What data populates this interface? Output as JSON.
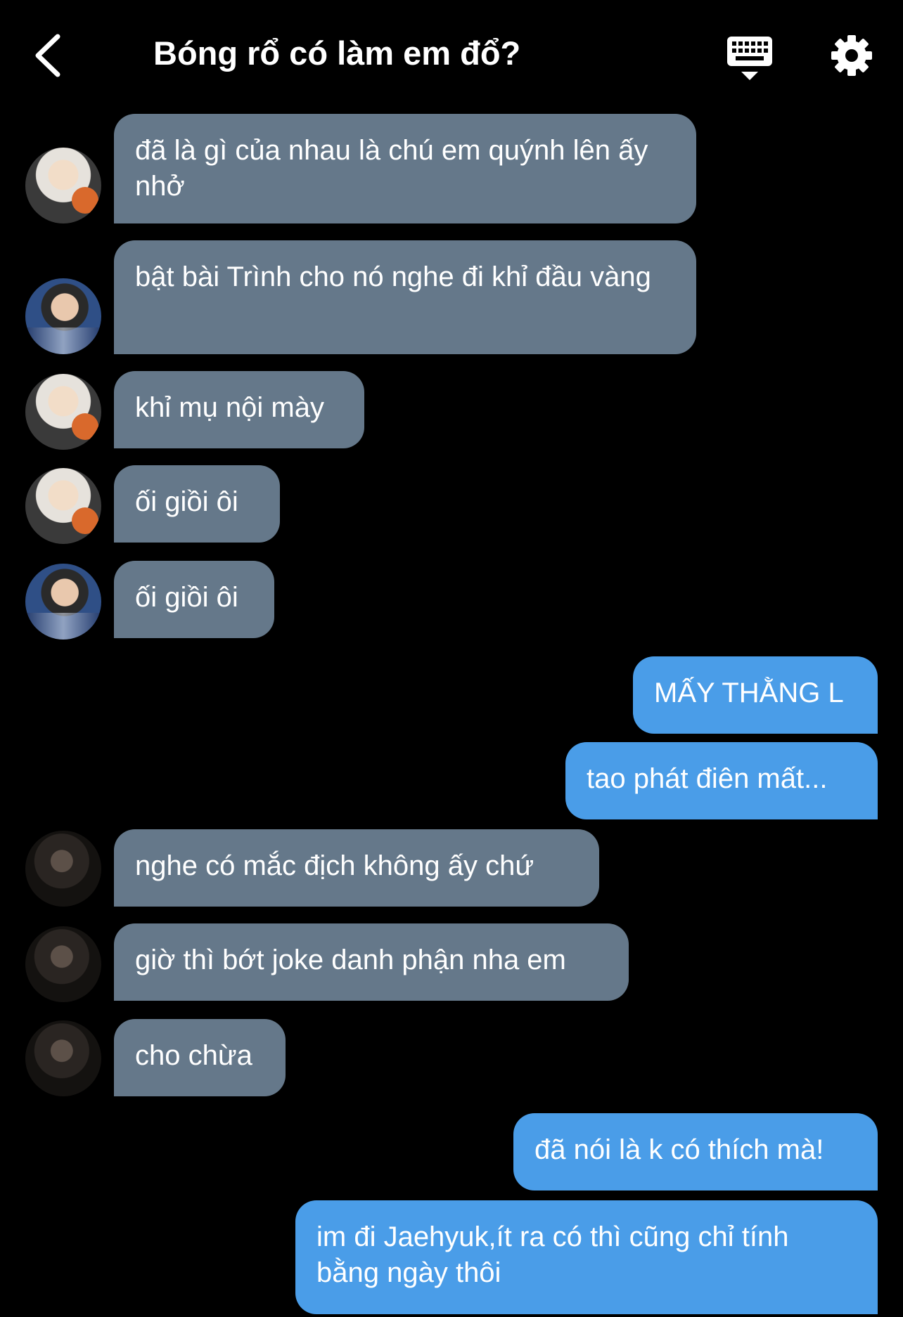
{
  "header": {
    "title": "Bóng rổ có làm em đổ?",
    "back_icon": "chevron-left-icon",
    "keyboard_icon": "keyboard-icon",
    "settings_icon": "gear-icon"
  },
  "colors": {
    "background": "#000000",
    "incoming_bubble": "#65788a",
    "outgoing_bubble": "#4a9de8",
    "text": "#ffffff"
  },
  "messages": [
    {
      "direction": "in",
      "avatar": "avatar-blond-basketball",
      "text": "đã là gì của nhau là chú em quýnh lên ấy nhở"
    },
    {
      "direction": "in",
      "avatar": "avatar-dark-hair-jacket",
      "text": "bật bài Trình cho nó nghe đi khỉ đầu vàng"
    },
    {
      "direction": "in",
      "avatar": "avatar-blond-basketball",
      "text": "khỉ mụ nội mày"
    },
    {
      "direction": "in",
      "avatar": "avatar-blond-basketball",
      "text": "ối giồi ôi"
    },
    {
      "direction": "in",
      "avatar": "avatar-dark-hair-jacket",
      "text": "ối giồi ôi"
    },
    {
      "direction": "out",
      "text": "MẤY THẰNG L"
    },
    {
      "direction": "out",
      "text": "tao phát điên mất..."
    },
    {
      "direction": "in",
      "avatar": "avatar-dark-covered-face",
      "text": "nghe có mắc địch không ấy chứ"
    },
    {
      "direction": "in",
      "avatar": "avatar-dark-covered-face",
      "text": "giờ thì bớt joke danh phận nha em"
    },
    {
      "direction": "in",
      "avatar": "avatar-dark-covered-face",
      "text": "cho chừa"
    },
    {
      "direction": "out",
      "text": "đã nói là k có thích mà!"
    },
    {
      "direction": "out",
      "text": "im đi Jaehyuk,ít ra có thì cũng chỉ tính bằng ngày thôi"
    }
  ]
}
